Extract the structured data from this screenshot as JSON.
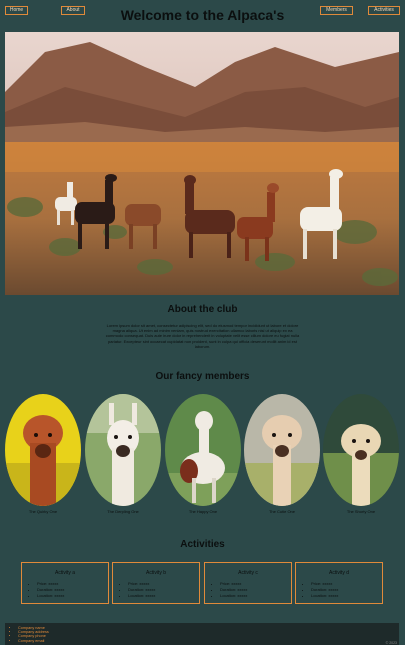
{
  "nav": {
    "home": "Home",
    "about": "About",
    "members": "Members",
    "activities": "Activities"
  },
  "header": {
    "title": "Welcome to the Alpaca's"
  },
  "about": {
    "title": "About the club",
    "text": "Lorem ipsum dolor sit amet, consectetur adipiscing elit, sed do eiusmod tempor incididunt ut labore et dolore magna aliqua. Ut enim ad minim veniam, quis nostrud exercitation ullamco laboris nisi ut aliquip ex ea commodo consequat. Duis aute irure dolor in reprehenderit in voluptate velit esse cillum dolore eu fugiat nulla pariatur. Excepteur sint occaecat cupidatat non proident, sunt in culpa qui officia deserunt mollit anim id est laborum."
  },
  "members": {
    "title": "Our fancy members",
    "items": [
      {
        "name": "The Quirky One"
      },
      {
        "name": "The Derpling One"
      },
      {
        "name": "The Happy One"
      },
      {
        "name": "The Cutie One"
      },
      {
        "name": "The Shorty One"
      }
    ]
  },
  "activities": {
    "title": "Activities",
    "items": [
      {
        "title": "Activity a",
        "details": [
          "Price: xxxxx",
          "Duration: xxxxx",
          "Location: xxxxx"
        ]
      },
      {
        "title": "Activity b",
        "details": [
          "Price: xxxxx",
          "Duration: xxxxx",
          "Location: xxxxx"
        ]
      },
      {
        "title": "Activity c",
        "details": [
          "Price: xxxxx",
          "Duration: xxxxx",
          "Location: xxxxx"
        ]
      },
      {
        "title": "Activity d",
        "details": [
          "Price: xxxxx",
          "Duration: xxxxx",
          "Location: xxxxx"
        ]
      }
    ]
  },
  "footer": {
    "lines": [
      "Company name",
      "Company address",
      "Company phone",
      "Company email"
    ],
    "copyright": "© 2023"
  },
  "colors": {
    "background": "#2c4949",
    "accent": "#e08a3a",
    "footer_bg": "#1e2a2a"
  }
}
